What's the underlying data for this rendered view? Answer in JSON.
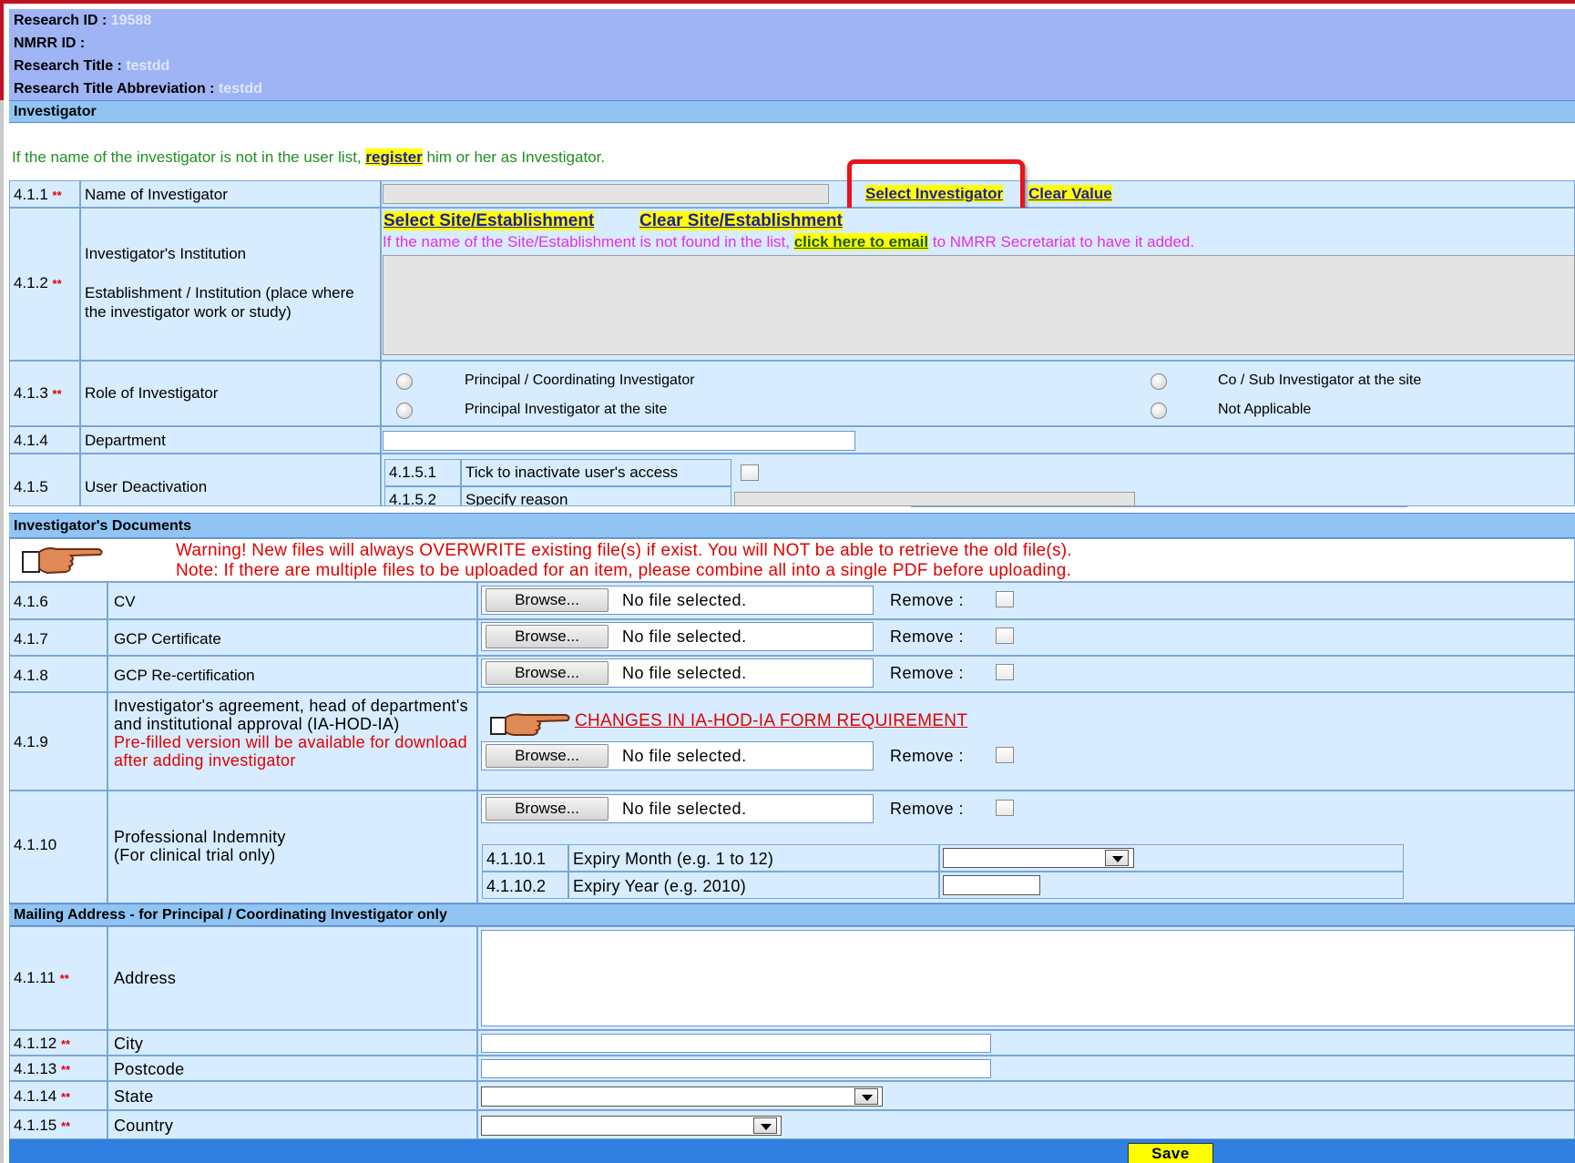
{
  "header": {
    "research_id_label": "Research ID :",
    "research_id_value": "19588",
    "nmrr_id_label": "NMRR ID :",
    "title_label": "Research Title :",
    "title_value": "testdd",
    "abbrev_label": "Research Title Abbreviation :",
    "abbrev_value": "testdd"
  },
  "investigator": {
    "section_title": "Investigator",
    "note_prefix": "If the name of the investigator is not in the user list,",
    "note_link": "register",
    "note_suffix": "him or her as Investigator.",
    "f411_num": "4.1.1",
    "f411_label": "Name of Investigator",
    "select_investigator": "Select Investigator",
    "clear_value": "Clear Value",
    "f412_num": "4.1.2",
    "f412_label1": "Investigator's Institution",
    "f412_label2": "Establishment / Institution (place where the investigator work or study)",
    "select_site": "Select Site/Establishment",
    "clear_site": "Clear Site/Establishment",
    "site_note_prefix": "If the name of the Site/Establishment is not found in the list,",
    "site_note_link": "click here to email",
    "site_note_suffix": "to NMRR Secretariat to have it added.",
    "f413_num": "4.1.3",
    "f413_label": "Role of Investigator",
    "role_options": [
      "Principal / Coordinating Investigator",
      "Co / Sub Investigator at the site",
      "Principal Investigator at the site",
      "Not Applicable"
    ],
    "f414_num": "4.1.4",
    "f414_label": "Department",
    "f415_num": "4.1.5",
    "f415_label": "User Deactivation",
    "f4151_num": "4.1.5.1",
    "f4151_label": "Tick to inactivate user's access",
    "f4152_num": "4.1.5.2",
    "f4152_label": "Specify reason",
    "required_mark": "**"
  },
  "documents": {
    "section_title": "Investigator's Documents",
    "warning_line1": "Warning! New files will always OVERWRITE existing file(s) if exist. You will NOT be able to retrieve the old file(s).",
    "warning_line2": "Note: If there are multiple files to be uploaded for an item, please combine all into a single PDF before uploading.",
    "browse_label": "Browse...",
    "no_file": "No file selected.",
    "remove_label": "Remove :",
    "rows": [
      {
        "num": "4.1.6",
        "label": "CV"
      },
      {
        "num": "4.1.7",
        "label": "GCP Certificate"
      },
      {
        "num": "4.1.8",
        "label": "GCP Re-certification"
      }
    ],
    "f419_num": "4.1.9",
    "f419_label": "Investigator's agreement, head of department's and institutional approval (IA-HOD-IA)",
    "f419_note": "Pre-filled version will be available for download after adding investigator",
    "changes_link": "CHANGES IN IA-HOD-IA FORM REQUIREMENT",
    "f4110_num": "4.1.10",
    "f4110_label1": "Professional Indemnity",
    "f4110_label2": "(For clinical trial only)",
    "f41101_num": "4.1.10.1",
    "f41101_label": "Expiry Month (e.g. 1 to 12)",
    "f41102_num": "4.1.10.2",
    "f41102_label": "Expiry Year (e.g. 2010)"
  },
  "mailing": {
    "section_title": "Mailing Address - for Principal / Coordinating Investigator only",
    "rows": [
      {
        "num": "4.1.11",
        "label": "Address"
      },
      {
        "num": "4.1.12",
        "label": "City"
      },
      {
        "num": "4.1.13",
        "label": "Postcode"
      },
      {
        "num": "4.1.14",
        "label": "State"
      },
      {
        "num": "4.1.15",
        "label": "Country"
      }
    ],
    "save_label": "Save"
  },
  "colors": {
    "header_bg": "#9fb4f5",
    "section_bg": "#8fc4f3",
    "cell_bg": "#d7ecff",
    "link_highlight": "#ffff00",
    "warning_red": "#e00000",
    "site_note_magenta": "#e62ee6",
    "highlight_box": "#e8131b",
    "footer_bar": "#2f80e0"
  },
  "icons": {
    "pointing_hand": "pointing-hand-icon"
  }
}
